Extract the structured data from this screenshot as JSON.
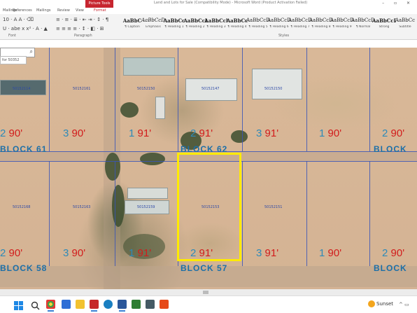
{
  "titlebar": {
    "picture_tools": "Picture Tools",
    "document_title": "Land and Lots for Sale (Compatibility Mode) - Microsoft Word (Product Activation Failed)",
    "window_controls": "–  ▫  ✕"
  },
  "tabs": [
    "Mailings",
    "References",
    "Mailings",
    "Review",
    "View",
    "Format"
  ],
  "ribbon": {
    "font_row1": "10  ·  A  A  ·  ⌫",
    "font_row2": "U · abe x x² · A · ▲",
    "para_row1": "≡ · ≡ · ≣ · ⇤ ⇥ · ↕ · ¶",
    "para_row2": "≡ ≡ ≡ ≡ · ↕ · ◧ · ⊞",
    "group_font": "Font",
    "group_paragraph": "Paragraph",
    "group_styles": "Styles",
    "styles": [
      {
        "sample": "AaBbC",
        "name": "¶ Caption"
      },
      {
        "sample": "AaBbCcDc",
        "name": "Emphasis"
      },
      {
        "sample": "AaBbCc",
        "name": "¶ Heading 1"
      },
      {
        "sample": "AaBbCcl",
        "name": "¶ Heading 2"
      },
      {
        "sample": "AaBbCcl",
        "name": "¶ Heading 3"
      },
      {
        "sample": "AaBbCc",
        "name": "¶ Heading 4"
      },
      {
        "sample": "AaBbCcDc",
        "name": "¶ Heading 5"
      },
      {
        "sample": "AaBbCcDc",
        "name": "¶ Heading 6"
      },
      {
        "sample": "AaBbCcDc",
        "name": "¶ Heading 7"
      },
      {
        "sample": "AaBbCcDc",
        "name": "¶ Heading 8"
      },
      {
        "sample": "AaBbCcDc",
        "name": "¶ Heading 9"
      },
      {
        "sample": "AaBbCcDc",
        "name": "¶ Normal"
      },
      {
        "sample": "AaBbCcDd",
        "name": "Strong"
      },
      {
        "sample": "AaBbCc",
        "name": "Subtitle"
      }
    ]
  },
  "search": {
    "placeholder": "",
    "nav_hint": "for 50352"
  },
  "map": {
    "top_row": [
      {
        "n": "2",
        "ft": "90'"
      },
      {
        "n": "3",
        "ft": "90'"
      },
      {
        "n": "1",
        "ft": "91'"
      },
      {
        "n": "2",
        "ft": "91'"
      },
      {
        "n": "3",
        "ft": "91'"
      },
      {
        "n": "1",
        "ft": "90'"
      },
      {
        "n": "2",
        "ft": "90'"
      }
    ],
    "bottom_row": [
      {
        "n": "2",
        "ft": "90'"
      },
      {
        "n": "3",
        "ft": "90'"
      },
      {
        "n": "1",
        "ft": "91'"
      },
      {
        "n": "2",
        "ft": "91'"
      },
      {
        "n": "3",
        "ft": "91'"
      },
      {
        "n": "1",
        "ft": "90'"
      },
      {
        "n": "2",
        "ft": "90'"
      }
    ],
    "blocks_mid": [
      "BLOCK  61",
      "BLOCK  62",
      "BLOCK"
    ],
    "blocks_bottom": [
      "BLOCK  58",
      "BLOCK  57",
      "BLOCK"
    ],
    "lot_ids_top": [
      "50152114",
      "50152161",
      "50152150",
      "50152147",
      "50152150"
    ],
    "lot_ids_bottom": [
      "50152168",
      "50152163",
      "50152159",
      "50152153",
      "50152151"
    ],
    "highlight_color": "#ffeb00"
  },
  "taskbar": {
    "weather": "Sunset",
    "tray": "^ ▭",
    "icons": [
      "windows-start-icon",
      "search-icon",
      "task-view-icon",
      "chrome-icon",
      "file-explorer-icon",
      "video-app-icon",
      "edge-icon",
      "acrobat-icon",
      "word-icon",
      "store-icon",
      "calculator-icon",
      "brave-icon"
    ]
  }
}
